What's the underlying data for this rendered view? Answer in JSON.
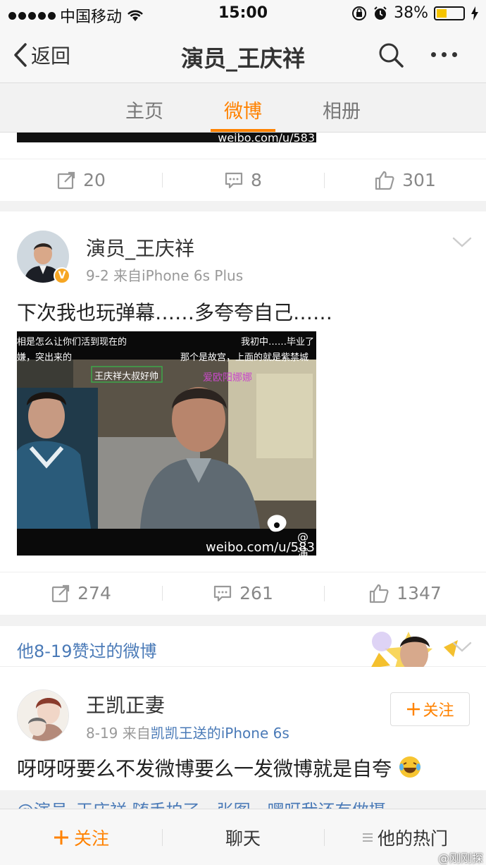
{
  "status_bar": {
    "carrier": "中国移动",
    "time": "15:00",
    "battery": "38%",
    "battery_level": 0.38
  },
  "nav": {
    "back_label": "返回",
    "title": "演员_王庆祥"
  },
  "tabs": [
    {
      "label": "主页"
    },
    {
      "label": "微博",
      "active": true
    },
    {
      "label": "相册"
    }
  ],
  "top_post": {
    "video_watermark": "weibo.com/u/583",
    "reposts": "20",
    "comments": "8",
    "likes": "301"
  },
  "post": {
    "username": "演员_王庆祥",
    "date": "9-2",
    "source": "来自iPhone 6s Plus",
    "text": "下次我也玩弹幕……多夸夸自己……",
    "danmaku": [
      "相是怎么让你们活到现在的",
      "我初中……毕业了",
      "嫌，突出来的",
      "那个是故宫，上面的就是紫禁城",
      "王庆祥大叔好帅",
      "爱欧阳娜娜"
    ],
    "video_watermark": "weibo.com/u/583",
    "video_at": "@演",
    "reposts": "274",
    "comments": "261",
    "likes": "1347"
  },
  "liked_section": {
    "title": "他8-19赞过的微博",
    "user": {
      "username": "王凯正妻",
      "date": "8-19",
      "source_prefix": "来自",
      "source_link": "凯凯王送的iPhone 6s",
      "follow_label": "关注"
    },
    "text": "呀呀呀要么不发微博要么一发微博就是自夸",
    "next_preview": "@演员_王庆祥 随手拍了一张图，嘿呀我还有做摄"
  },
  "bottom_bar": {
    "follow": "关注",
    "chat": "聊天",
    "hot": "他的热门"
  },
  "corner_watermark": "@刚刚探",
  "colors": {
    "accent": "#ff8200",
    "link": "#4a7ab7",
    "verified": "#f6a623"
  }
}
